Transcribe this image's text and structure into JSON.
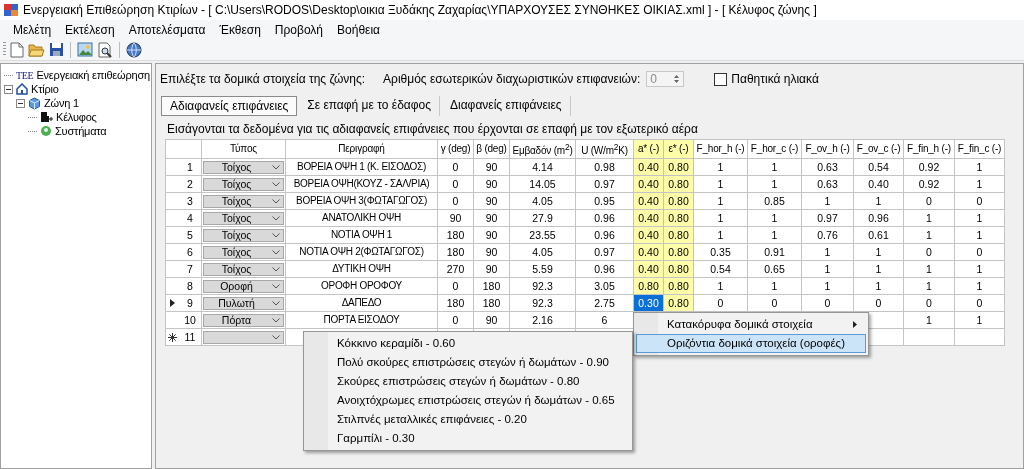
{
  "window": {
    "title": "Ενεργειακή Επιθεώρηση Κτιρίων - [ C:\\Users\\RODOS\\Desktop\\οικια Ξυδάκης Ζαχαρίας\\ΥΠΑΡΧΟΥΣΕΣ ΣΥΝΘΗΚΕΣ ΟΙΚΙΑΣ.xml ] - [ Κέλυφος ζώνης ]"
  },
  "menu": [
    "Μελέτη",
    "Εκτέλεση",
    "Αποτελέσματα",
    "Έκθεση",
    "Προβολή",
    "Βοήθεια"
  ],
  "tree": [
    {
      "kind": "root",
      "logo": "ΤΕΕ",
      "label": "Ενεργειακή επιθεώρηση"
    },
    {
      "kind": "building",
      "label": "Κτίριο",
      "expanded": true,
      "children": [
        {
          "kind": "zone",
          "label": "Ζώνη 1",
          "expanded": true,
          "children": [
            {
              "kind": "envelope",
              "label": "Κέλυφος"
            },
            {
              "kind": "systems",
              "label": "Συστήματα"
            }
          ]
        }
      ]
    }
  ],
  "zone_header": {
    "prompt": "Επιλέξτε τα δομικά στοιχεία της ζώνης:",
    "partitions_label": "Αριθμός εσωτερικών διαχωριστικών επιφανειών:",
    "partitions_value": "0",
    "partitions_disabled": true,
    "passive_solar": {
      "label": "Παθητικά ηλιακά",
      "checked": false
    }
  },
  "tabs": [
    {
      "label": "Αδιαφανείς επιφάνειες",
      "selected": true
    },
    {
      "label": "Σε επαφή με το έδαφος",
      "selected": false
    },
    {
      "label": "Διαφανείς επιφάνειες",
      "selected": false
    }
  ],
  "description": "Εισάγονται τα δεδομένα για τις αδιαφανείς επιφάνειες που έρχονται σε επαφή με τον εξωτερικό αέρα",
  "table": {
    "columns": [
      {
        "label": "Τύπος",
        "kind": "dropdown",
        "highlight": false
      },
      {
        "label": "Περιγραφή",
        "kind": "text",
        "highlight": false
      },
      {
        "label": "γ (deg)",
        "kind": "text",
        "highlight": false
      },
      {
        "label": "β (deg)",
        "kind": "text",
        "highlight": false
      },
      {
        "label": "Εμβαδόν (m$^{2}$)",
        "kind": "text",
        "highlight": false
      },
      {
        "label": "U (W/m$^{2}$K)",
        "kind": "text",
        "highlight": false
      },
      {
        "label": "a* (-)",
        "kind": "text",
        "highlight": true
      },
      {
        "label": "ε* (-)",
        "kind": "text",
        "highlight": true
      },
      {
        "label": "F_hor_h (-)",
        "kind": "text",
        "highlight": false
      },
      {
        "label": "F_hor_c (-)",
        "kind": "text",
        "highlight": false
      },
      {
        "label": "F_ov_h (-)",
        "kind": "text",
        "highlight": false
      },
      {
        "label": "F_ov_c (-)",
        "kind": "text",
        "highlight": false
      },
      {
        "label": "F_fin_h (-)",
        "kind": "text",
        "highlight": false
      },
      {
        "label": "F_fin_c (-)",
        "kind": "text",
        "highlight": false
      }
    ],
    "rows": [
      {
        "kind": "data",
        "number": "1",
        "current": false,
        "cells": [
          {
            "text": "Τοίχος",
            "selected": false
          },
          {
            "text": "ΒΟΡΕΙΑ ΟΨΗ 1 (Κ. ΕΙΣΟΔΟΣ)",
            "selected": false
          },
          {
            "text": "0",
            "selected": false
          },
          {
            "text": "90",
            "selected": false
          },
          {
            "text": "4.14",
            "selected": false
          },
          {
            "text": "0.98",
            "selected": false
          },
          {
            "text": "0.40",
            "selected": false
          },
          {
            "text": "0.80",
            "selected": false
          },
          {
            "text": "1",
            "selected": false
          },
          {
            "text": "1",
            "selected": false
          },
          {
            "text": "0.63",
            "selected": false
          },
          {
            "text": "0.54",
            "selected": false
          },
          {
            "text": "0.92",
            "selected": false
          },
          {
            "text": "1",
            "selected": false
          }
        ]
      },
      {
        "kind": "data",
        "number": "2",
        "current": false,
        "cells": [
          {
            "text": "Τοίχος",
            "selected": false
          },
          {
            "text": "ΒΟΡΕΙΑ ΟΨΗ(ΚΟΥΖ - ΣΑΛ/ΡΙΑ)",
            "selected": false
          },
          {
            "text": "0",
            "selected": false
          },
          {
            "text": "90",
            "selected": false
          },
          {
            "text": "14.05",
            "selected": false
          },
          {
            "text": "0.97",
            "selected": false
          },
          {
            "text": "0.40",
            "selected": false
          },
          {
            "text": "0.80",
            "selected": false
          },
          {
            "text": "1",
            "selected": false
          },
          {
            "text": "1",
            "selected": false
          },
          {
            "text": "0.63",
            "selected": false
          },
          {
            "text": "0.40",
            "selected": false
          },
          {
            "text": "0.92",
            "selected": false
          },
          {
            "text": "1",
            "selected": false
          }
        ]
      },
      {
        "kind": "data",
        "number": "3",
        "current": false,
        "cells": [
          {
            "text": "Τοίχος",
            "selected": false
          },
          {
            "text": "ΒΟΡΕΙΑ ΟΨΗ 3(ΦΩΤΑΓΩΓΟΣ)",
            "selected": false
          },
          {
            "text": "0",
            "selected": false
          },
          {
            "text": "90",
            "selected": false
          },
          {
            "text": "4.05",
            "selected": false
          },
          {
            "text": "0.95",
            "selected": false
          },
          {
            "text": "0.40",
            "selected": false
          },
          {
            "text": "0.80",
            "selected": false
          },
          {
            "text": "1",
            "selected": false
          },
          {
            "text": "0.85",
            "selected": false
          },
          {
            "text": "1",
            "selected": false
          },
          {
            "text": "1",
            "selected": false
          },
          {
            "text": "0",
            "selected": false
          },
          {
            "text": "0",
            "selected": false
          }
        ]
      },
      {
        "kind": "data",
        "number": "4",
        "current": false,
        "cells": [
          {
            "text": "Τοίχος",
            "selected": false
          },
          {
            "text": "ΑΝΑΤΟΛΙΚΗ ΟΨΗ",
            "selected": false
          },
          {
            "text": "90",
            "selected": false
          },
          {
            "text": "90",
            "selected": false
          },
          {
            "text": "27.9",
            "selected": false
          },
          {
            "text": "0.96",
            "selected": false
          },
          {
            "text": "0.40",
            "selected": false
          },
          {
            "text": "0.80",
            "selected": false
          },
          {
            "text": "1",
            "selected": false
          },
          {
            "text": "1",
            "selected": false
          },
          {
            "text": "0.97",
            "selected": false
          },
          {
            "text": "0.96",
            "selected": false
          },
          {
            "text": "1",
            "selected": false
          },
          {
            "text": "1",
            "selected": false
          }
        ]
      },
      {
        "kind": "data",
        "number": "5",
        "current": false,
        "cells": [
          {
            "text": "Τοίχος",
            "selected": false
          },
          {
            "text": "ΝΟΤΙΑ ΟΨΗ 1",
            "selected": false
          },
          {
            "text": "180",
            "selected": false
          },
          {
            "text": "90",
            "selected": false
          },
          {
            "text": "23.55",
            "selected": false
          },
          {
            "text": "0.96",
            "selected": false
          },
          {
            "text": "0.40",
            "selected": false
          },
          {
            "text": "0.80",
            "selected": false
          },
          {
            "text": "1",
            "selected": false
          },
          {
            "text": "1",
            "selected": false
          },
          {
            "text": "0.76",
            "selected": false
          },
          {
            "text": "0.61",
            "selected": false
          },
          {
            "text": "1",
            "selected": false
          },
          {
            "text": "1",
            "selected": false
          }
        ]
      },
      {
        "kind": "data",
        "number": "6",
        "current": false,
        "cells": [
          {
            "text": "Τοίχος",
            "selected": false
          },
          {
            "text": "ΝΟΤΙΑ ΟΨΗ 2(ΦΩΤΑΓΩΓΟΣ)",
            "selected": false
          },
          {
            "text": "180",
            "selected": false
          },
          {
            "text": "90",
            "selected": false
          },
          {
            "text": "4.05",
            "selected": false
          },
          {
            "text": "0.97",
            "selected": false
          },
          {
            "text": "0.40",
            "selected": false
          },
          {
            "text": "0.80",
            "selected": false
          },
          {
            "text": "0.35",
            "selected": false
          },
          {
            "text": "0.91",
            "selected": false
          },
          {
            "text": "1",
            "selected": false
          },
          {
            "text": "1",
            "selected": false
          },
          {
            "text": "0",
            "selected": false
          },
          {
            "text": "0",
            "selected": false
          }
        ]
      },
      {
        "kind": "data",
        "number": "7",
        "current": false,
        "cells": [
          {
            "text": "Τοίχος",
            "selected": false
          },
          {
            "text": "ΔΥΤΙΚΗ ΟΨΗ",
            "selected": false
          },
          {
            "text": "270",
            "selected": false
          },
          {
            "text": "90",
            "selected": false
          },
          {
            "text": "5.59",
            "selected": false
          },
          {
            "text": "0.96",
            "selected": false
          },
          {
            "text": "0.40",
            "selected": false
          },
          {
            "text": "0.80",
            "selected": false
          },
          {
            "text": "0.54",
            "selected": false
          },
          {
            "text": "0.65",
            "selected": false
          },
          {
            "text": "1",
            "selected": false
          },
          {
            "text": "1",
            "selected": false
          },
          {
            "text": "1",
            "selected": false
          },
          {
            "text": "1",
            "selected": false
          }
        ]
      },
      {
        "kind": "data",
        "number": "8",
        "current": false,
        "cells": [
          {
            "text": "Οροφή",
            "selected": false
          },
          {
            "text": "ΟΡΟΦΗ ΟΡΟΦΟΥ",
            "selected": false
          },
          {
            "text": "0",
            "selected": false
          },
          {
            "text": "180",
            "selected": false
          },
          {
            "text": "92.3",
            "selected": false
          },
          {
            "text": "3.05",
            "selected": false
          },
          {
            "text": "0.80",
            "selected": false
          },
          {
            "text": "0.80",
            "selected": false
          },
          {
            "text": "1",
            "selected": false
          },
          {
            "text": "1",
            "selected": false
          },
          {
            "text": "1",
            "selected": false
          },
          {
            "text": "1",
            "selected": false
          },
          {
            "text": "1",
            "selected": false
          },
          {
            "text": "1",
            "selected": false
          }
        ]
      },
      {
        "kind": "data",
        "number": "9",
        "current": true,
        "cells": [
          {
            "text": "Πυλωτή",
            "selected": false
          },
          {
            "text": "ΔΑΠΕΔΟ",
            "selected": false
          },
          {
            "text": "180",
            "selected": false
          },
          {
            "text": "180",
            "selected": false
          },
          {
            "text": "92.3",
            "selected": false
          },
          {
            "text": "2.75",
            "selected": false
          },
          {
            "text": "0.30",
            "selected": true
          },
          {
            "text": "0.80",
            "selected": false
          },
          {
            "text": "0",
            "selected": false
          },
          {
            "text": "0",
            "selected": false
          },
          {
            "text": "0",
            "selected": false
          },
          {
            "text": "0",
            "selected": false
          },
          {
            "text": "0",
            "selected": false
          },
          {
            "text": "0",
            "selected": false
          }
        ]
      },
      {
        "kind": "data",
        "number": "10",
        "current": false,
        "cells": [
          {
            "text": "Πόρτα",
            "selected": false
          },
          {
            "text": "ΠΟΡΤΑ ΕΙΣΟΔΟΥ",
            "selected": false
          },
          {
            "text": "0",
            "selected": false
          },
          {
            "text": "90",
            "selected": false
          },
          {
            "text": "2.16",
            "selected": false
          },
          {
            "text": "6",
            "selected": false
          },
          null,
          null,
          null,
          null,
          null,
          null,
          {
            "text": "1",
            "selected": false
          },
          {
            "text": "1",
            "selected": false
          }
        ]
      },
      {
        "kind": "new",
        "number": "11",
        "current": false,
        "cells": [
          {
            "selected": false
          },
          {
            "selected": false
          },
          null,
          null,
          null,
          null,
          null,
          null,
          null,
          null,
          null,
          null,
          {
            "selected": false
          },
          {
            "selected": false
          }
        ]
      }
    ],
    "context_menu": {
      "items": [
        {
          "label": "Κατακόρυφα δομικά στοιχεία",
          "has_submenu": true,
          "selected": false
        },
        {
          "label": "Οριζόντια δομικά στοιχεία (οροφές)",
          "has_submenu": true,
          "selected": true
        }
      ],
      "submenu": [
        {
          "label": "Κόκκινο κεραμίδι - 0.60",
          "selected": false
        },
        {
          "label": "Πολύ σκούρες επιστρώσεις στεγών ή δωμάτων - 0.90",
          "selected": false
        },
        {
          "label": "Σκούρες επιστρώσεις στεγών ή δωμάτων - 0.80",
          "selected": false
        },
        {
          "label": "Ανοιχτόχρωμες επιστρώσεις στεγών ή δωμάτων - 0.65",
          "selected": false
        },
        {
          "label": "Στιλπνές μεταλλικές επιφάνειες - 0.20",
          "selected": false
        },
        {
          "label": "Γαρμπίλι - 0.30",
          "selected": false
        }
      ]
    }
  }
}
